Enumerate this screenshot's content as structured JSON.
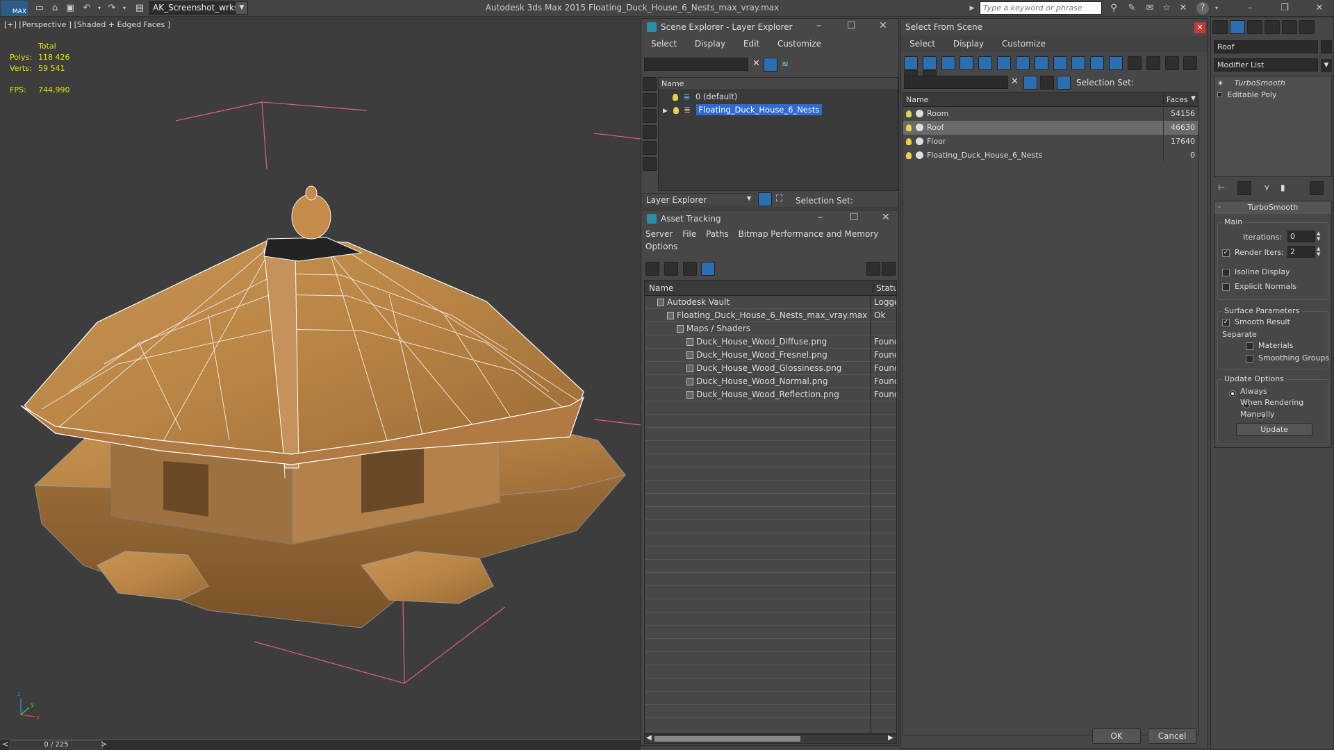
{
  "titlebar": {
    "logo": "MAX",
    "workspace": "AK_Screenshot_wrksp",
    "app_title": "Autodesk 3ds Max  2015     Floating_Duck_House_6_Nests_max_vray.max",
    "search_placeholder": "Type a keyword or phrase"
  },
  "viewport": {
    "label": "[+] [Perspective ] [Shaded + Edged Faces ]",
    "stats": {
      "total_label": "Total",
      "polys_label": "Polys:",
      "polys_value": "118 426",
      "verts_label": "Verts:",
      "verts_value": "59 541",
      "fps_label": "FPS:",
      "fps_value": "744,990"
    },
    "axis": {
      "x": "x",
      "y": "y",
      "z": "z"
    }
  },
  "timeline": {
    "prev": "<",
    "frame": "0 / 225",
    "next": ">"
  },
  "scene_explorer": {
    "title": "Scene Explorer - Layer Explorer",
    "menu": [
      "Select",
      "Display",
      "Edit",
      "Customize"
    ],
    "column_name": "Name",
    "layers": [
      {
        "name": "0 (default)",
        "selected": false
      },
      {
        "name": "Floating_Duck_House_6_Nests",
        "selected": true
      }
    ],
    "footer_dropdown": "Layer Explorer",
    "selection_set_label": "Selection Set:"
  },
  "asset_tracking": {
    "title": "Asset Tracking",
    "menu": [
      "Server",
      "File",
      "Paths",
      "Bitmap Performance and Memory",
      "Options"
    ],
    "col_name": "Name",
    "col_status": "Status",
    "rows": [
      {
        "name": "Autodesk Vault",
        "status": "Logge",
        "indent": 0
      },
      {
        "name": "Floating_Duck_House_6_Nests_max_vray.max",
        "status": "Ok",
        "indent": 1
      },
      {
        "name": "Maps / Shaders",
        "status": "",
        "indent": 2
      },
      {
        "name": "Duck_House_Wood_Diffuse.png",
        "status": "Found",
        "indent": 3
      },
      {
        "name": "Duck_House_Wood_Fresnel.png",
        "status": "Found",
        "indent": 3
      },
      {
        "name": "Duck_House_Wood_Glossiness.png",
        "status": "Found",
        "indent": 3
      },
      {
        "name": "Duck_House_Wood_Normal.png",
        "status": "Found",
        "indent": 3
      },
      {
        "name": "Duck_House_Wood_Reflection.png",
        "status": "Found",
        "indent": 3
      }
    ]
  },
  "select_from_scene": {
    "title": "Select From Scene",
    "menu": [
      "Select",
      "Display",
      "Customize"
    ],
    "selection_set_label": "Selection Set:",
    "col_name": "Name",
    "col_faces": "Faces",
    "rows": [
      {
        "name": "Room",
        "faces": "54156",
        "selected": false
      },
      {
        "name": "Roof",
        "faces": "46630",
        "selected": true
      },
      {
        "name": "Floor",
        "faces": "17640",
        "selected": false
      },
      {
        "name": "Floating_Duck_House_6_Nests",
        "faces": "0",
        "selected": false
      }
    ],
    "ok": "OK",
    "cancel": "Cancel"
  },
  "command_panel": {
    "object_name": "Roof",
    "modifier_list": "Modifier List",
    "stack": [
      "TurboSmooth",
      "Editable Poly"
    ],
    "rollout_title": "TurboSmooth",
    "main_group": "Main",
    "iterations_label": "Iterations:",
    "iterations_value": "0",
    "render_iters_label": "Render Iters:",
    "render_iters_value": "2",
    "isoline_label": "Isoline Display",
    "explicit_normals_label": "Explicit Normals",
    "surface_group": "Surface Parameters",
    "smooth_result_label": "Smooth Result",
    "separate_label": "Separate",
    "materials_label": "Materials",
    "smoothing_groups_label": "Smoothing Groups",
    "update_group": "Update Options",
    "always_label": "Always",
    "when_rendering_label": "When Rendering",
    "manually_label": "Manually",
    "update_button": "Update"
  }
}
